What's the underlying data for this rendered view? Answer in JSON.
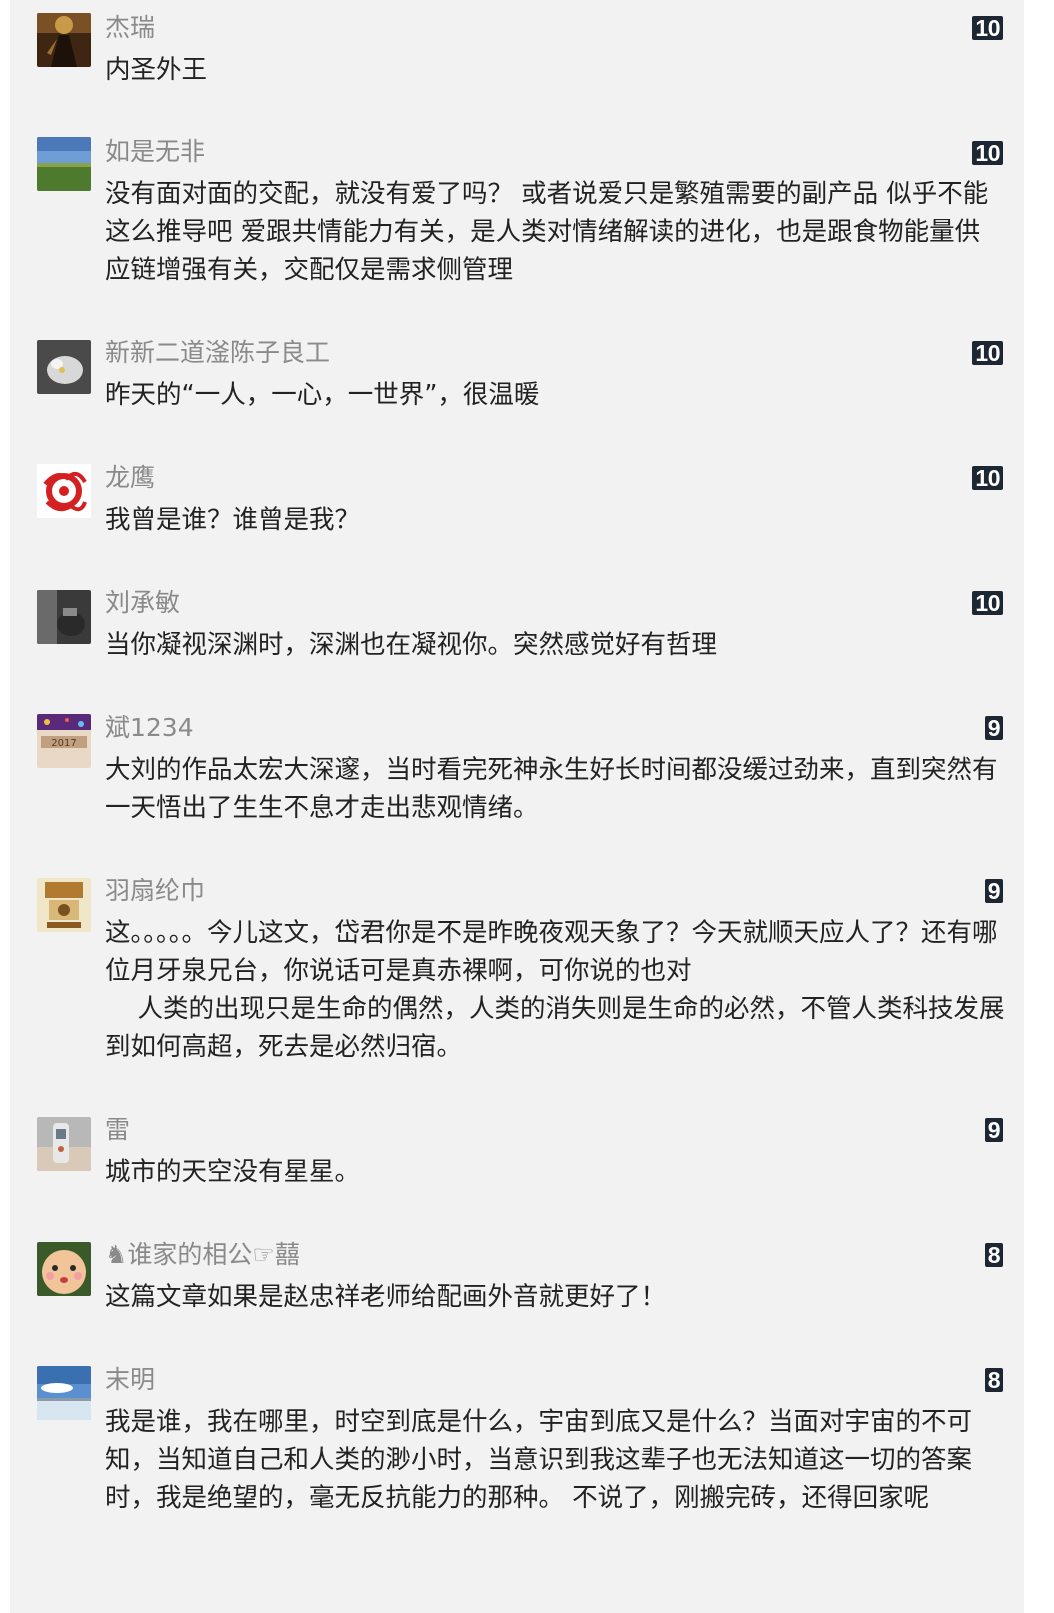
{
  "comments": [
    {
      "author": "杰瑞",
      "likes": "10",
      "text": "内圣外王",
      "avatar_colors": [
        "#5a3a1e",
        "#c89a4a"
      ],
      "avatar_icon": "avatar-icon"
    },
    {
      "author": "如是无非",
      "likes": "10",
      "text": "没有面对面的交配，就没有爱了吗？ 或者说爱只是繁殖需要的副产品 似乎不能这么推导吧 爱跟共情能力有关，是人类对情绪解读的进化，也是跟食物能量供应链增强有关，交配仅是需求侧管理",
      "avatar_colors": [
        "#6f9dd6",
        "#4e7a2e"
      ],
      "avatar_icon": "avatar-icon"
    },
    {
      "author": "新新二道滏陈子良工",
      "likes": "10",
      "text": "昨天的“一人，一心，一世界”，很温暖",
      "avatar_colors": [
        "#6a6a6a",
        "#d8d8d8"
      ],
      "avatar_icon": "avatar-icon"
    },
    {
      "author": "龙鹰",
      "likes": "10",
      "text": "我曾是谁？谁曾是我？",
      "avatar_colors": [
        "#ffffff",
        "#d32020"
      ],
      "avatar_icon": "avatar-icon"
    },
    {
      "author": "刘承敏",
      "likes": "10",
      "text": "当你凝视深渊时，深渊也在凝视你。突然感觉好有哲理",
      "avatar_colors": [
        "#2a2a2a",
        "#7a7a7a"
      ],
      "avatar_icon": "avatar-icon"
    },
    {
      "author": "斌1234",
      "likes": "9",
      "text": "大刘的作品太宏大深邃，当时看完死神永生好长时间都没缓过劲来，直到突然有一天悟出了生生不息才走出悲观情绪。",
      "avatar_colors": [
        "#7a2a8a",
        "#e9d8c6"
      ],
      "avatar_icon": "avatar-icon"
    },
    {
      "author": "羽扇纶巾",
      "likes": "9",
      "text": "这。。。。。今儿这文，岱君你是不是昨晚夜观天象了？今天就顺天应人了？还有哪位月牙泉兄台，你说话可是真赤裸啊，可你说的也对\n    人类的出现只是生命的偶然，人类的消失则是生命的必然，不管人类科技发展到如何高超，死去是必然归宿。",
      "avatar_colors": [
        "#f0e6c8",
        "#b07a30"
      ],
      "avatar_icon": "avatar-icon"
    },
    {
      "author": "雷",
      "likes": "9",
      "text": "城市的天空没有星星。",
      "avatar_colors": [
        "#a8a8a8",
        "#d9c9b9"
      ],
      "avatar_icon": "avatar-icon"
    },
    {
      "author": "♞谁家的相公☞囍",
      "likes": "8",
      "text": "这篇文章如果是赵忠祥老师给配画外音就更好了！",
      "avatar_colors": [
        "#3a5a2a",
        "#f2c49a"
      ],
      "avatar_icon": "avatar-icon"
    },
    {
      "author": "末明",
      "likes": "8",
      "text": "我是谁，我在哪里，时空到底是什么，宇宙到底又是什么？当面对宇宙的不可知，当知道自己和人类的渺小时，当意识到我这辈子也无法知道这一切的答案时，我是绝望的，毫无反抗能力的那种。 不说了，刚搬完砖，还得回家呢",
      "avatar_colors": [
        "#5a8fd0",
        "#d8e6f2"
      ],
      "avatar_icon": "avatar-icon"
    }
  ]
}
